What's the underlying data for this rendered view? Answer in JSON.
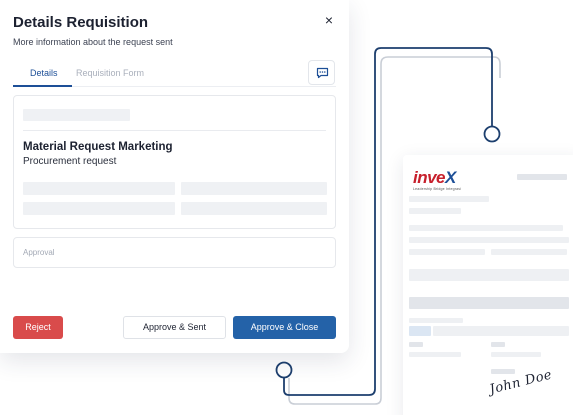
{
  "modal": {
    "title": "Details Requisition",
    "subtitle": "More information about the request sent",
    "close_label": "×"
  },
  "tabs": [
    {
      "label": "Details",
      "active": true
    },
    {
      "label": "Requisition Form",
      "active": false
    }
  ],
  "card": {
    "title": "Material Request Marketing",
    "subtitle": "Procurement request"
  },
  "approval": {
    "label": "Approval"
  },
  "buttons": {
    "reject": "Reject",
    "approve_sent": "Approve & Sent",
    "approve_close": "Approve & Close"
  },
  "document": {
    "logo_text": "inve",
    "logo_x": "X",
    "logo_tagline": "Leadership Bridge Integrasi",
    "signature": "John Doe"
  },
  "colors": {
    "accent": "#1d4f97",
    "primary_button": "#2462a8",
    "reject_button": "#d94b4b",
    "connector_dark": "#1d3f6e",
    "connector_light": "#c9ced6"
  }
}
